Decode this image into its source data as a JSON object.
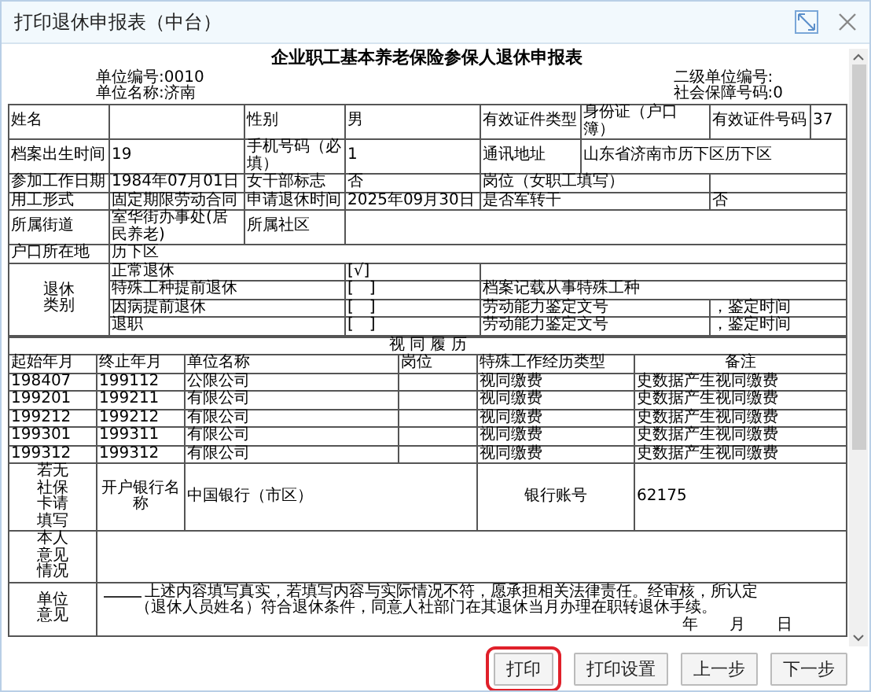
{
  "window": {
    "title": "打印退休申报表（中台）"
  },
  "document": {
    "title": "企业职工基本养老保险参保人退休申报表",
    "info_left": [
      "单位编号:0010",
      "单位名称:济南"
    ],
    "info_right": [
      "二级单位编号:",
      "社会保障号码:0"
    ],
    "upper_rows": [
      {
        "cells": [
          {
            "kind": "label",
            "text": "姓名"
          },
          {
            "kind": "value"
          },
          {
            "kind": "label",
            "text": "性别"
          },
          {
            "kind": "value",
            "text": "男"
          },
          {
            "kind": "label",
            "text": "有效证件类型"
          },
          {
            "kind": "value",
            "text": "身份证（户口簿）"
          },
          {
            "kind": "label",
            "text": "有效证件号码"
          },
          {
            "kind": "value",
            "text": "37"
          }
        ]
      },
      {
        "cells": [
          {
            "kind": "label",
            "text": "档案出生时间"
          },
          {
            "kind": "value",
            "text": "19"
          },
          {
            "kind": "label",
            "text": "手机号码（必填）"
          },
          {
            "kind": "value",
            "text": "1"
          },
          {
            "kind": "label",
            "text": "通讯地址"
          },
          {
            "kind": "value",
            "text": "山东省济南市历下区历下区",
            "colspan": 3
          }
        ]
      },
      {
        "cells": [
          {
            "kind": "label",
            "text": "参加工作日期"
          },
          {
            "kind": "value",
            "text": "1984年07月01日"
          },
          {
            "kind": "label",
            "text": "女干部标志"
          },
          {
            "kind": "value",
            "text": "否"
          },
          {
            "kind": "label",
            "text": "岗位（女职工填写）",
            "colspan": 2
          },
          {
            "kind": "value",
            "colspan": 2
          }
        ]
      },
      {
        "cells": [
          {
            "kind": "label",
            "text": "用工形式"
          },
          {
            "kind": "value",
            "text": "固定期限劳动合同"
          },
          {
            "kind": "label",
            "text": "申请退休时间"
          },
          {
            "kind": "value",
            "text": "2025年09月30日"
          },
          {
            "kind": "label",
            "text": "是否军转干",
            "colspan": 2
          },
          {
            "kind": "value",
            "text": "否",
            "colspan": 2
          }
        ]
      },
      {
        "cells": [
          {
            "kind": "label",
            "text": "所属街道"
          },
          {
            "kind": "value",
            "text": "室华街办事处(居民养老)"
          },
          {
            "kind": "label",
            "text": "所属社区"
          },
          {
            "kind": "value",
            "colspan": 5
          }
        ]
      },
      {
        "cells": [
          {
            "kind": "label",
            "text": "户口所在地"
          },
          {
            "kind": "value",
            "text": "历下区",
            "colspan": 7
          }
        ]
      },
      {
        "cells": [
          {
            "kind": "vlabel",
            "text": "退休类别",
            "rowspan": 4
          },
          {
            "kind": "label",
            "text": "正常退休",
            "colspan": 2
          },
          {
            "kind": "value",
            "text": "[√]"
          },
          {
            "kind": "value",
            "colspan": 4
          }
        ]
      },
      {
        "cells": [
          {
            "kind": "label",
            "text": "特殊工种提前退休",
            "colspan": 2
          },
          {
            "kind": "value",
            "text": "[　]"
          },
          {
            "kind": "value",
            "text": "档案记载从事特殊工种",
            "colspan": 4
          }
        ]
      },
      {
        "cells": [
          {
            "kind": "label",
            "text": "因病提前退休",
            "colspan": 2
          },
          {
            "kind": "value",
            "text": "[　]"
          },
          {
            "kind": "value",
            "text": "劳动能力鉴定文号",
            "colspan": 2
          },
          {
            "kind": "value",
            "text": "，鉴定时间",
            "colspan": 2
          }
        ]
      },
      {
        "cells": [
          {
            "kind": "label",
            "text": "退职",
            "colspan": 2
          },
          {
            "kind": "value",
            "text": "[　]"
          },
          {
            "kind": "value",
            "text": "劳动能力鉴定文号",
            "colspan": 2
          },
          {
            "kind": "value",
            "text": "，鉴定时间",
            "colspan": 2
          }
        ]
      }
    ],
    "lower_rows": [
      {
        "cells": [
          {
            "kind": "heading",
            "text": "视 同 履 历",
            "colspan": 6
          }
        ]
      },
      {
        "cells": [
          {
            "kind": "label",
            "text": "起始年月"
          },
          {
            "kind": "label",
            "text": "终止年月"
          },
          {
            "kind": "label",
            "text": "单位名称"
          },
          {
            "kind": "label",
            "text": "岗位"
          },
          {
            "kind": "label",
            "text": "特殊工作经历类型"
          },
          {
            "kind": "heading",
            "text": "备注"
          }
        ]
      },
      {
        "cells": [
          {
            "kind": "value",
            "text": "198407"
          },
          {
            "kind": "value",
            "text": "199112"
          },
          {
            "kind": "value",
            "text": "公限公司"
          },
          {
            "kind": "value"
          },
          {
            "kind": "value",
            "text": "视同缴费"
          },
          {
            "kind": "value",
            "text": "史数据产生视同缴费"
          }
        ]
      },
      {
        "cells": [
          {
            "kind": "value",
            "text": "199201"
          },
          {
            "kind": "value",
            "text": "199211"
          },
          {
            "kind": "value",
            "text": "有限公司"
          },
          {
            "kind": "value"
          },
          {
            "kind": "value",
            "text": "视同缴费"
          },
          {
            "kind": "value",
            "text": "史数据产生视同缴费"
          }
        ]
      },
      {
        "cells": [
          {
            "kind": "value",
            "text": "199212"
          },
          {
            "kind": "value",
            "text": "199212"
          },
          {
            "kind": "value",
            "text": "有限公司"
          },
          {
            "kind": "value"
          },
          {
            "kind": "value",
            "text": "视同缴费"
          },
          {
            "kind": "value",
            "text": "史数据产生视同缴费"
          }
        ]
      },
      {
        "cells": [
          {
            "kind": "value",
            "text": "199301"
          },
          {
            "kind": "value",
            "text": "199311"
          },
          {
            "kind": "value",
            "text": "有限公司"
          },
          {
            "kind": "value"
          },
          {
            "kind": "value",
            "text": "视同缴费"
          },
          {
            "kind": "value",
            "text": "史数据产生视同缴费"
          }
        ]
      },
      {
        "cells": [
          {
            "kind": "value",
            "text": "199312"
          },
          {
            "kind": "value",
            "text": "199312"
          },
          {
            "kind": "value",
            "text": "有限公司"
          },
          {
            "kind": "value"
          },
          {
            "kind": "value",
            "text": "视同缴费"
          },
          {
            "kind": "value",
            "text": "史数据产生视同缴费"
          }
        ]
      },
      {
        "cells": [
          {
            "kind": "vlabel",
            "text": "若无社保卡请填写"
          },
          {
            "kind": "heading",
            "text": "开户银行名称"
          },
          {
            "kind": "value",
            "text": "中国银行（市区）",
            "colspan": 2
          },
          {
            "kind": "heading",
            "text": "银行账号"
          },
          {
            "kind": "value",
            "text": "62175"
          }
        ]
      },
      {
        "cells": [
          {
            "kind": "vlabel",
            "text": "本人意见情况"
          },
          {
            "kind": "value",
            "colspan": 5
          }
        ]
      },
      {
        "cells": [
          {
            "kind": "vlabel",
            "text": "单位意见"
          },
          {
            "kind": "statement",
            "colspan": 5,
            "lines": [
              "上述内容填写真实，若填写内容与实际情况不符，愿承担相关法律责任。经审核，所认定",
              "（退休人员姓名）符合退休条件，同意人社部门在其退休当月办理在职转退休手续。"
            ],
            "date": "年　　月　　日"
          }
        ]
      }
    ]
  },
  "buttons": [
    {
      "label": "打印",
      "highlighted": true
    },
    {
      "label": "打印设置",
      "highlighted": false
    },
    {
      "label": "上一步",
      "highlighted": false
    },
    {
      "label": "下一步",
      "highlighted": false
    }
  ]
}
